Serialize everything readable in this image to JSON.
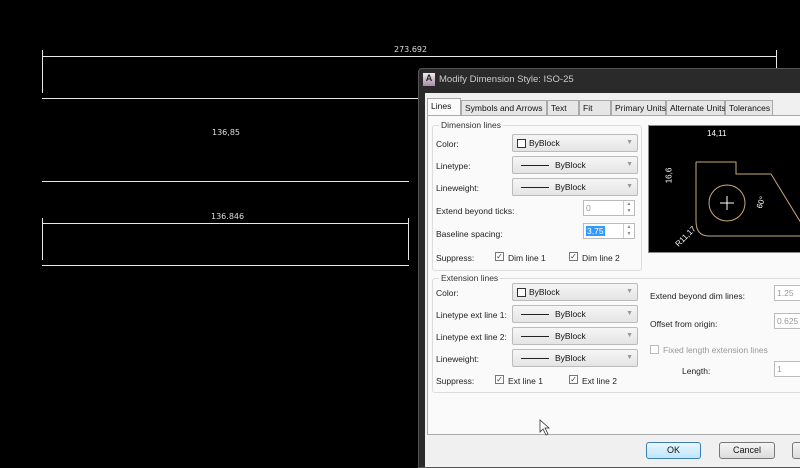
{
  "drawing": {
    "dim_top": "273.692",
    "dim_middle": "136,85",
    "dim_bottom": "136.846"
  },
  "dialog": {
    "title": "Modify Dimension Style: ISO-25",
    "tabs": [
      "Lines",
      "Symbols and Arrows",
      "Text",
      "Fit",
      "Primary Units",
      "Alternate Units",
      "Tolerances"
    ],
    "active_tab": "Lines",
    "dimension_lines": {
      "group": "Dimension lines",
      "color_label": "Color:",
      "color_value": "ByBlock",
      "linetype_label": "Linetype:",
      "linetype_value": "ByBlock",
      "lineweight_label": "Lineweight:",
      "lineweight_value": "ByBlock",
      "extend_label": "Extend beyond ticks:",
      "extend_value": "0",
      "baseline_label": "Baseline spacing:",
      "baseline_value": "3.75",
      "suppress_label": "Suppress:",
      "dim_line1": "Dim line 1",
      "dim_line1_checked": true,
      "dim_line2": "Dim line 2",
      "dim_line2_checked": true
    },
    "preview": {
      "top": "14,11",
      "left": "16,6",
      "angle": "60°",
      "radius": "R11,17"
    },
    "extension_lines": {
      "group": "Extension lines",
      "color_label": "Color:",
      "color_value": "ByBlock",
      "lt1_label": "Linetype ext line 1:",
      "lt1_value": "ByBlock",
      "lt2_label": "Linetype ext line 2:",
      "lt2_value": "ByBlock",
      "lineweight_label": "Lineweight:",
      "lineweight_value": "ByBlock",
      "suppress_label": "Suppress:",
      "ext_line1": "Ext line 1",
      "ext_line1_checked": true,
      "ext_line2": "Ext line 2",
      "ext_line2_checked": true,
      "extend_dim_label": "Extend beyond dim lines:",
      "extend_dim_value": "1.25",
      "offset_label": "Offset from origin:",
      "offset_value": "0.625",
      "fixed_label": "Fixed length extension lines",
      "fixed_checked": false,
      "length_label": "Length:",
      "length_value": "1"
    },
    "buttons": {
      "ok": "OK",
      "cancel": "Cancel"
    }
  }
}
